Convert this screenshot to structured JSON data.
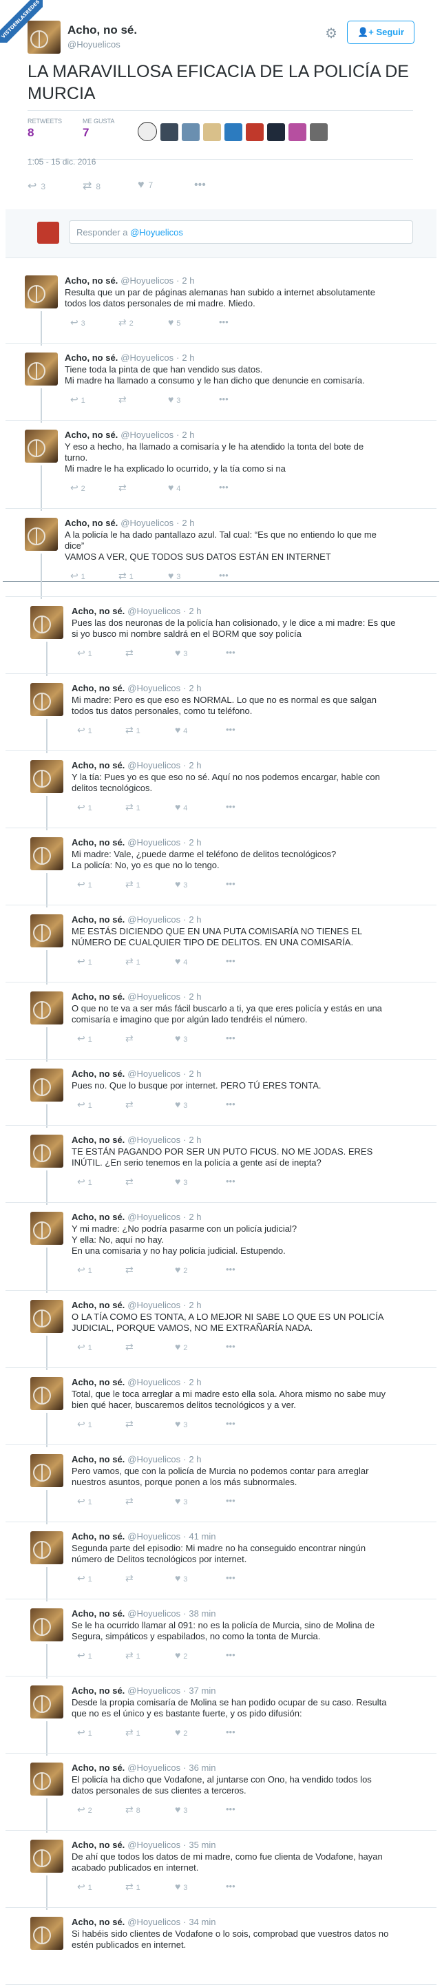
{
  "watermark": "VISTOENLASREDES",
  "header": {
    "name": "Acho, no sé.",
    "handle": "@Hoyuelicos",
    "follow_label": "Seguir",
    "gear_icon": "gear-icon"
  },
  "main_tweet": {
    "text": "LA MARAVILLOSA EFICACIA DE LA POLICÍA DE MURCIA",
    "retweets_label": "RETWEETS",
    "retweets": "8",
    "likes_label": "ME GUSTA",
    "likes": "7",
    "time": "1:05 - 15 dic. 2016",
    "reply_count": "3",
    "retweet_count": "8",
    "like_count": "7"
  },
  "reply_box": {
    "placeholder_prefix": "Responder a ",
    "placeholder_handle": "@Hoyuelicos"
  },
  "replies": [
    {
      "name": "Acho, no sé.",
      "handle": "@Hoyuelicos",
      "time": "2 h",
      "lines": [
        "Resulta que un par de páginas alemanas han subido a internet absolutamente",
        "todos los datos personales de mi madre. Miedo."
      ],
      "reply": "3",
      "rt": "2",
      "like": "5"
    },
    {
      "name": "Acho, no sé.",
      "handle": "@Hoyuelicos",
      "time": "2 h",
      "lines": [
        "Tiene toda la pinta de que han vendido sus datos.",
        "Mi madre ha llamado a consumo y le han dicho que denuncie en comisaría."
      ],
      "reply": "1",
      "rt": "",
      "like": "3"
    },
    {
      "name": "Acho, no sé.",
      "handle": "@Hoyuelicos",
      "time": "2 h",
      "lines": [
        "Y eso a hecho, ha llamado a comisaría y le ha atendido la tonta del bote de",
        "turno.",
        "Mi madre le ha explicado lo ocurrido, y la tía como si na"
      ],
      "reply": "2",
      "rt": "",
      "like": "4"
    },
    {
      "name": "Acho, no sé.",
      "handle": "@Hoyuelicos",
      "time": "2 h",
      "lines": [
        "A la policía le ha dado pantallazo azul. Tal cual: “Es que no entiendo lo que me",
        "dice”",
        "VAMOS A VER, QUE TODOS SUS DATOS ESTÁN EN INTERNET"
      ],
      "reply": "1",
      "rt": "1",
      "like": "3"
    },
    {
      "name": "Acho, no sé.",
      "handle": "@Hoyuelicos",
      "time": "2 h",
      "lines": [
        "Pues las dos neuronas de la policía han colisionado, y le dice a mi madre: Es que",
        "si yo busco mi nombre saldrá en el BORM que soy policía"
      ],
      "reply": "1",
      "rt": "",
      "like": "3"
    },
    {
      "name": "Acho, no sé.",
      "handle": "@Hoyuelicos",
      "time": "2 h",
      "lines": [
        "Mi madre: Pero es que eso es NORMAL. Lo que no es normal es que salgan",
        "todos tus datos personales, como tu teléfono."
      ],
      "reply": "1",
      "rt": "1",
      "like": "4"
    },
    {
      "name": "Acho, no sé.",
      "handle": "@Hoyuelicos",
      "time": "2 h",
      "lines": [
        "Y la tía: Pues yo es que eso no sé. Aquí no nos podemos encargar, hable con",
        "delitos tecnológicos."
      ],
      "reply": "1",
      "rt": "1",
      "like": "4"
    },
    {
      "name": "Acho, no sé.",
      "handle": "@Hoyuelicos",
      "time": "2 h",
      "lines": [
        "Mi madre: Vale, ¿puede darme el teléfono de delitos tecnológicos?",
        "La policía: No, yo es que no lo tengo."
      ],
      "reply": "1",
      "rt": "1",
      "like": "3"
    },
    {
      "name": "Acho, no sé.",
      "handle": "@Hoyuelicos",
      "time": "2 h",
      "lines": [
        "ME ESTÁS DICIENDO QUE EN UNA PUTA COMISARÍA NO TIENES EL",
        "NÚMERO DE CUALQUIER TIPO DE DELITOS. EN UNA COMISARÍA."
      ],
      "reply": "1",
      "rt": "1",
      "like": "4"
    },
    {
      "name": "Acho, no sé.",
      "handle": "@Hoyuelicos",
      "time": "2 h",
      "lines": [
        "O que no te va a ser más fácil buscarlo a ti, ya que eres policía y estás en una",
        "comisaría e imagino que por algún lado tendréis el número."
      ],
      "reply": "1",
      "rt": "",
      "like": "3"
    },
    {
      "name": "Acho, no sé.",
      "handle": "@Hoyuelicos",
      "time": "2 h",
      "lines": [
        "Pues no. Que lo busque por internet. PERO TÚ ERES TONTA."
      ],
      "reply": "1",
      "rt": "",
      "like": "3"
    },
    {
      "name": "Acho, no sé.",
      "handle": "@Hoyuelicos",
      "time": "2 h",
      "lines": [
        "TE ESTÁN PAGANDO POR SER UN PUTO FICUS. NO ME JODAS. ERES",
        "INÚTIL. ¿En serio tenemos en la policía a gente así de inepta?"
      ],
      "reply": "1",
      "rt": "",
      "like": "3"
    },
    {
      "name": "Acho, no sé.",
      "handle": "@Hoyuelicos",
      "time": "2 h",
      "lines": [
        "Y mi madre: ¿No podría pasarme con un policía judicial?",
        "Y ella: No, aquí no hay.",
        "En una comisaria y no hay policía judicial. Estupendo."
      ],
      "reply": "1",
      "rt": "",
      "like": "2"
    },
    {
      "name": "Acho, no sé.",
      "handle": "@Hoyuelicos",
      "time": "2 h",
      "lines": [
        "O LA TÍA COMO ES TONTA, A LO MEJOR NI SABE LO QUE ES UN POLICÍA",
        "JUDICIAL, PORQUE VAMOS, NO ME EXTRAÑARÍA NADA."
      ],
      "reply": "1",
      "rt": "",
      "like": "2"
    },
    {
      "name": "Acho, no sé.",
      "handle": "@Hoyuelicos",
      "time": "2 h",
      "lines": [
        "Total, que le toca arreglar a mi madre esto ella sola. Ahora mismo no sabe muy",
        "bien qué hacer, buscaremos delitos tecnológicos y a ver."
      ],
      "reply": "1",
      "rt": "",
      "like": "3"
    },
    {
      "name": "Acho, no sé.",
      "handle": "@Hoyuelicos",
      "time": "2 h",
      "lines": [
        "Pero vamos, que con la policía de Murcia no podemos contar para arreglar",
        "nuestros asuntos, porque ponen a los más subnormales."
      ],
      "reply": "1",
      "rt": "",
      "like": "3"
    },
    {
      "name": "Acho, no sé.",
      "handle": "@Hoyuelicos",
      "time": "41 min",
      "lines": [
        "Segunda parte del episodio: Mi madre no ha conseguido encontrar ningún",
        "número de Delitos tecnológicos por internet."
      ],
      "reply": "1",
      "rt": "",
      "like": "3"
    },
    {
      "name": "Acho, no sé.",
      "handle": "@Hoyuelicos",
      "time": "38 min",
      "lines": [
        "Se le ha ocurrido llamar al 091: no es la policía de Murcia, sino de Molina de",
        "Segura, simpáticos y espabilados, no como la tonta de Murcia."
      ],
      "reply": "1",
      "rt": "1",
      "like": "2"
    },
    {
      "name": "Acho, no sé.",
      "handle": "@Hoyuelicos",
      "time": "37 min",
      "lines": [
        "Desde la propia comisaría de Molina se han podido ocupar de su caso. Resulta",
        "que no es el único y es bastante fuerte, y os pido difusión:"
      ],
      "reply": "1",
      "rt": "1",
      "like": "2"
    },
    {
      "name": "Acho, no sé.",
      "handle": "@Hoyuelicos",
      "time": "36 min",
      "lines": [
        "El policía ha dicho que Vodafone, al juntarse con Ono, ha vendido todos los",
        "datos personales de sus clientes a terceros."
      ],
      "reply": "2",
      "rt": "8",
      "like": "3"
    },
    {
      "name": "Acho, no sé.",
      "handle": "@Hoyuelicos",
      "time": "35 min",
      "lines": [
        "De ahí que todos los datos de mi madre, como fue clienta de Vodafone, hayan",
        "acabado publicados en internet."
      ],
      "reply": "1",
      "rt": "1",
      "like": "3"
    },
    {
      "name": "Acho, no sé.",
      "handle": "@Hoyuelicos",
      "time": "34 min",
      "lines": [
        "Si habéis sido clientes de Vodafone o lo sois, comprobad que vuestros datos no",
        "estén publicados en internet."
      ],
      "reply": "",
      "rt": "",
      "like": ""
    }
  ],
  "colors": {
    "accent": "#1da1f2",
    "stat": "#8c2ba5",
    "muted": "#8899a6"
  }
}
